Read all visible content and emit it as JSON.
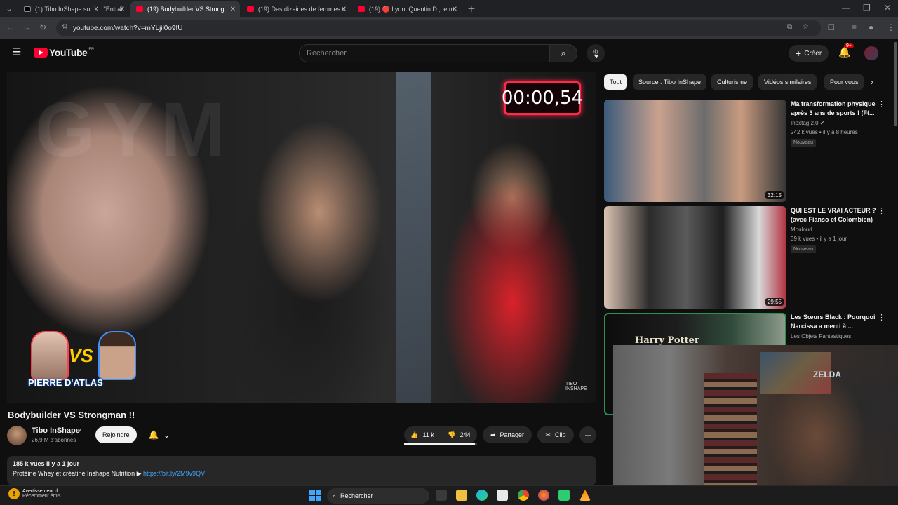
{
  "browser": {
    "tabs": [
      {
        "label": "(1) Tibo InShape sur X : \"Entraîn",
        "icon": "x-logo"
      },
      {
        "label": "(19) Bodybuilder VS Strong",
        "icon": "youtube-logo",
        "active": true
      },
      {
        "label": "(19) Des dizaines de femmes v",
        "icon": "youtube-logo"
      },
      {
        "label": "(19) 🔴 Lyon: Quentin D., le mi",
        "icon": "youtube-logo"
      }
    ],
    "url": "youtube.com/watch?v=mYLjil0o9fU"
  },
  "youtube": {
    "logo_text": "YouTube",
    "region": "FR",
    "search_placeholder": "Rechercher",
    "create_label": "Créer",
    "notif_count": "9+"
  },
  "video": {
    "timer": "00:00,54",
    "overlay_vs": "VS",
    "overlay_name": "PIERRE D'ATLAS",
    "watermark": "TIBO INSHAPE",
    "title": "Bodybuilder VS Strongman !!",
    "channel": "Tibo InShape",
    "subscribers": "26,9 M d'abonnés",
    "join_label": "Rejoindre",
    "likes": "11 k",
    "dislikes": "244",
    "share_label": "Partager",
    "clip_label": "Clip",
    "like_ratio": 0.97,
    "views_date": "185 k vues  il y a 1 jour",
    "desc_text": "Protéine Whey et créatine Inshape Nutrition ▶",
    "desc_link": "https://bit.ly/2M9v9QV"
  },
  "chips": [
    "Tout",
    "Source : Tibo InShape",
    "Culturisme",
    "Vidéos similaires",
    "Pour vous"
  ],
  "recommendations": [
    {
      "title": "Ma transformation physique après 3 ans de sports ! (Ft...",
      "channel": "Inoxtag 2.0 ✔",
      "stats": "242 k vues • il y a 8 heures",
      "badge": "Nouveau",
      "duration": "32:15"
    },
    {
      "title": "QUI EST LE VRAI ACTEUR ? (avec Fianso et Colombien)",
      "channel": "Mouloud",
      "stats": "39 k vues • il y a 1 jour",
      "badge": "Nouveau",
      "duration": "29:55"
    },
    {
      "title": "Les Sœurs Black : Pourquoi Narcissa a menti à ...",
      "channel": "Les Objets Fantastiques",
      "stats": "",
      "badge": "",
      "duration": "",
      "thumb_text": "Harry Potter"
    }
  ],
  "webcam": {
    "poster_text": "ZELDA"
  },
  "taskbar": {
    "alert_title": "Avertissement d...",
    "alert_sub": "Récemment émis",
    "search_label": "Rechercher"
  }
}
